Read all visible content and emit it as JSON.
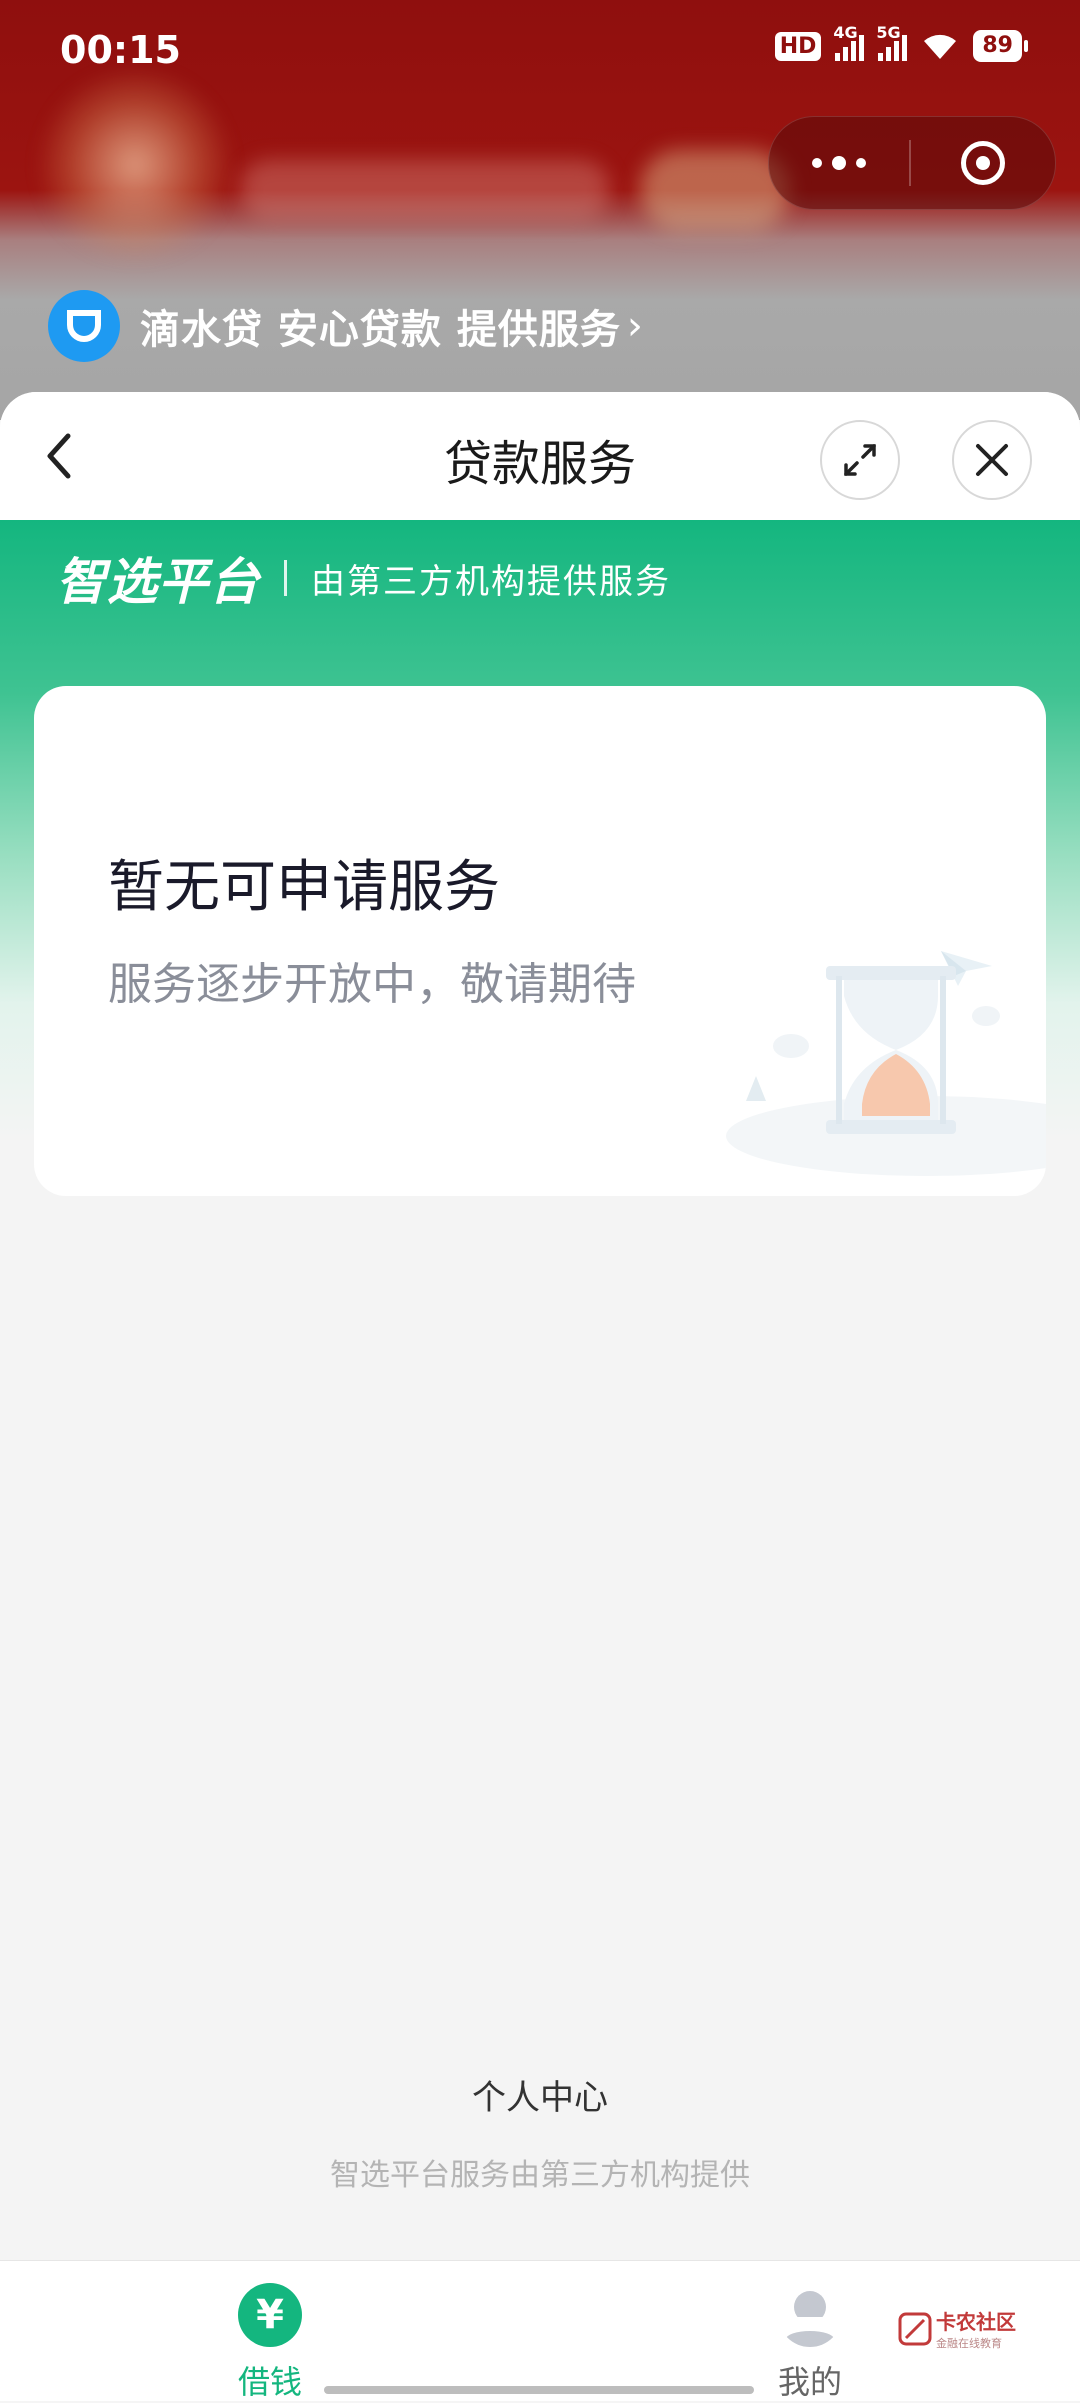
{
  "status_bar": {
    "time": "00:15",
    "hd_label": "HD",
    "network_1": "4G",
    "network_2": "5G",
    "battery": "89"
  },
  "provider": {
    "text": "滴水贷 安心贷款 提供服务",
    "chevron": "›",
    "logo_icon": "didi-logo-icon"
  },
  "sheet": {
    "title": "贷款服务"
  },
  "platform": {
    "logo": "智选平台",
    "subtitle": "由第三方机构提供服务"
  },
  "empty_card": {
    "title": "暂无可申请服务",
    "subtitle": "服务逐步开放中，敬请期待",
    "illustration": "hourglass-illustration"
  },
  "footer": {
    "personal_center": "个人中心",
    "note": "智选平台服务由第三方机构提供"
  },
  "tabs": [
    {
      "label": "借钱",
      "icon": "yen-icon",
      "active": true
    },
    {
      "label": "我的",
      "icon": "user-icon",
      "active": false
    }
  ],
  "watermark": {
    "title": "卡农社区",
    "subtitle": "金融在线教育"
  },
  "colors": {
    "brand_green": "#14b67f",
    "banner_red": "#8f0f0e",
    "provider_blue": "#1e9af2"
  }
}
